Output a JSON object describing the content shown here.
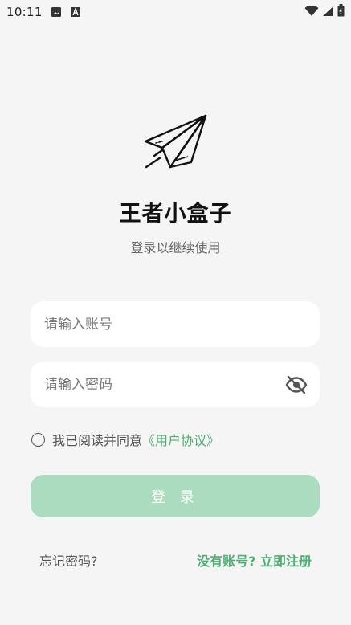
{
  "status_bar": {
    "time": "10:11",
    "icons": [
      "image-icon",
      "text-icon",
      "wifi-icon",
      "signal-icon",
      "battery-icon"
    ]
  },
  "app": {
    "title": "王者小盒子",
    "subtitle": "登录以继续使用",
    "logo_icon": "paper-plane-icon"
  },
  "form": {
    "account_placeholder": "请输入账号",
    "account_value": "",
    "password_placeholder": "请输入密码",
    "password_value": "",
    "password_toggle_icon": "eye-off-icon",
    "agreement_text": "我已阅读并同意",
    "agreement_link": "《用户协议》",
    "agreement_checked": false,
    "login_label": "登 录"
  },
  "footer": {
    "forgot_password": "忘记密码?",
    "register": "没有账号? 立即注册"
  },
  "colors": {
    "accent": "#4fae73",
    "button_disabled": "#acdcbf",
    "background": "#f5f5f5"
  }
}
